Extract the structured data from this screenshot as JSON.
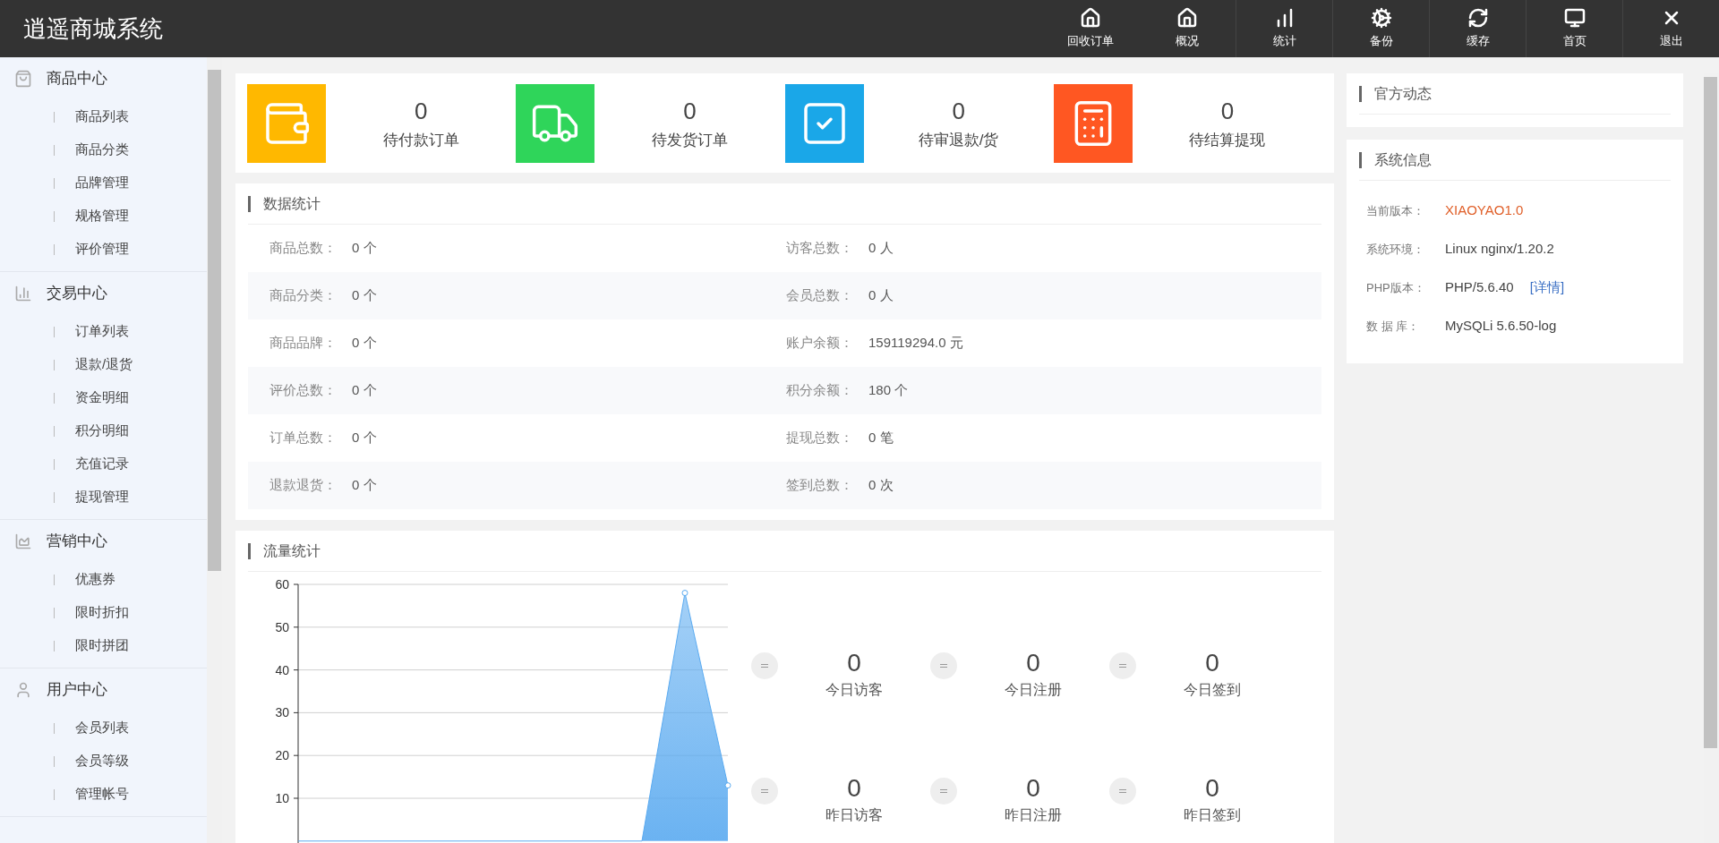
{
  "app_title": "逍遥商城系统",
  "top_nav": [
    {
      "label": "回收订单"
    },
    {
      "label": "概况"
    },
    {
      "label": "统计"
    },
    {
      "label": "备份"
    },
    {
      "label": "缓存"
    },
    {
      "label": "首页"
    },
    {
      "label": "退出"
    }
  ],
  "sidebar": {
    "sections": [
      {
        "title": "商品中心",
        "items": [
          "商品列表",
          "商品分类",
          "品牌管理",
          "规格管理",
          "评价管理"
        ]
      },
      {
        "title": "交易中心",
        "items": [
          "订单列表",
          "退款/退货",
          "资金明细",
          "积分明细",
          "充值记录",
          "提现管理"
        ]
      },
      {
        "title": "营销中心",
        "items": [
          "优惠券",
          "限时折扣",
          "限时拼团"
        ]
      },
      {
        "title": "用户中心",
        "items": [
          "会员列表",
          "会员等级",
          "管理帐号"
        ]
      }
    ]
  },
  "pending": [
    {
      "count": "0",
      "label": "待付款订单",
      "color": "#ffb800"
    },
    {
      "count": "0",
      "label": "待发货订单",
      "color": "#2fd55a"
    },
    {
      "count": "0",
      "label": "待审退款/货",
      "color": "#1aa7e8"
    },
    {
      "count": "0",
      "label": "待结算提现",
      "color": "#ff5722"
    }
  ],
  "data_stats": {
    "title": "数据统计",
    "rows": [
      {
        "left": {
          "label": "商品总数：",
          "value": "0 个"
        },
        "right": {
          "label": "访客总数：",
          "value": "0 人"
        }
      },
      {
        "left": {
          "label": "商品分类：",
          "value": "0 个"
        },
        "right": {
          "label": "会员总数：",
          "value": "0 人"
        }
      },
      {
        "left": {
          "label": "商品品牌：",
          "value": "0 个"
        },
        "right": {
          "label": "账户余额：",
          "value": "159119294.0 元"
        }
      },
      {
        "left": {
          "label": "评价总数：",
          "value": "0 个"
        },
        "right": {
          "label": "积分余额：",
          "value": "180 个"
        }
      },
      {
        "left": {
          "label": "订单总数：",
          "value": "0 个"
        },
        "right": {
          "label": "提现总数：",
          "value": "0 笔"
        }
      },
      {
        "left": {
          "label": "退款退货：",
          "value": "0 个"
        },
        "right": {
          "label": "签到总数：",
          "value": "0 次"
        }
      }
    ]
  },
  "traffic": {
    "title": "流量统计",
    "chart_data": {
      "type": "area",
      "color": "#5aaaf0",
      "values": [
        0,
        0,
        0,
        0,
        0,
        0,
        0,
        0,
        0,
        58,
        13
      ],
      "ylim": [
        0,
        60
      ],
      "yticks": [
        10,
        20,
        30,
        40,
        50,
        60
      ],
      "grid": true
    },
    "stats": [
      {
        "value": "0",
        "label": "今日访客"
      },
      {
        "value": "0",
        "label": "今日注册"
      },
      {
        "value": "0",
        "label": "今日签到"
      },
      {
        "value": "0",
        "label": "昨日访客"
      },
      {
        "value": "0",
        "label": "昨日注册"
      },
      {
        "value": "0",
        "label": "昨日签到"
      }
    ]
  },
  "news": {
    "title": "官方动态"
  },
  "system_info": {
    "title": "系统信息",
    "rows": [
      {
        "label": "当前版本：",
        "value": "XIAOYAO1.0",
        "kind": "highlight"
      },
      {
        "label": "系统环境：",
        "value": "Linux nginx/1.20.2",
        "kind": "plain"
      },
      {
        "label": "PHP版本：",
        "value": "PHP/5.6.40",
        "kind": "plain",
        "link": "[详情]"
      },
      {
        "label": "数 据 库：",
        "value": "MySQLi 5.6.50-log",
        "kind": "plain"
      }
    ]
  }
}
